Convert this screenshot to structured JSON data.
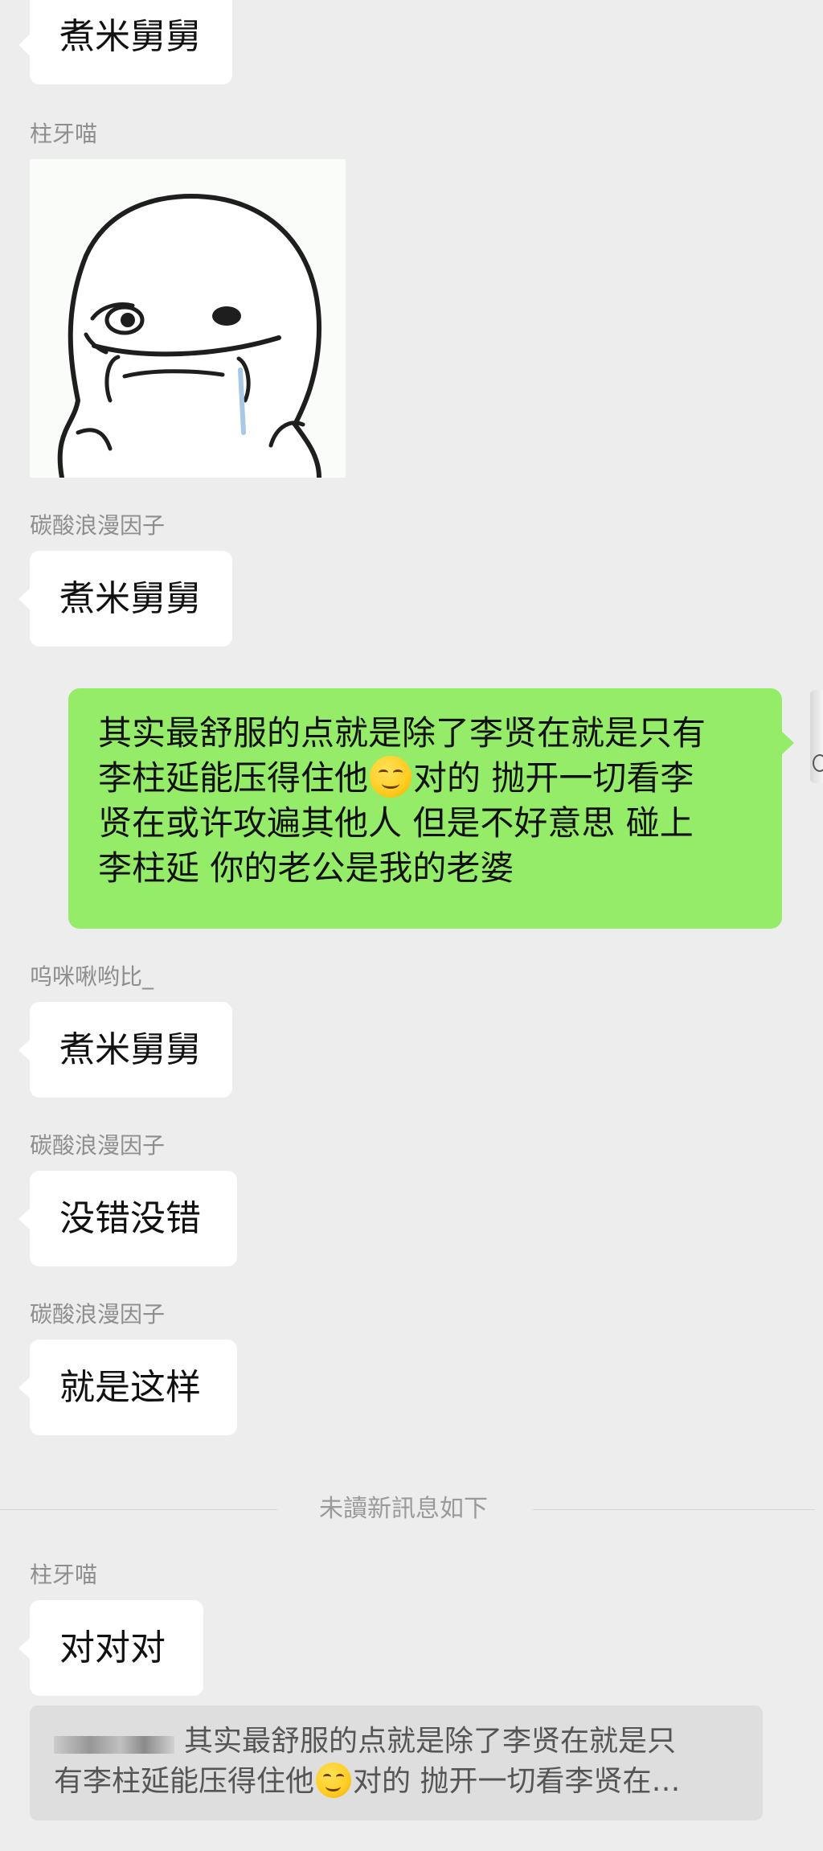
{
  "messages": [
    {
      "kind": "text",
      "text": "煮米舅舅"
    },
    {
      "kind": "sender",
      "name": "柱牙喵"
    },
    {
      "kind": "sticker"
    },
    {
      "kind": "sender",
      "name": "碳酸浪漫因子"
    },
    {
      "kind": "text",
      "text": "煮米舅舅"
    }
  ],
  "mine": {
    "line1": "其实最舒服的点就是除了李贤在就是只有",
    "line2a": "李柱延能压得住他",
    "line2b": "对的 抛开一切看李",
    "line3": "贤在或许攻遍其他人 但是不好意思 碰上",
    "line4": "李柱延 你的老公是我的老婆",
    "emoji": "smirk-face-icon"
  },
  "after": [
    {
      "sender": "呜咪啾哟比_",
      "text": "煮米舅舅"
    },
    {
      "sender": "碳酸浪漫因子",
      "text": "没错没错"
    },
    {
      "sender": "碳酸浪漫因子",
      "text": "就是这样"
    }
  ],
  "divider": "未讀新訊息如下",
  "unread": {
    "sender": "柱牙喵",
    "text": "对对对"
  },
  "quote": {
    "line1": "其实最舒服的点就是除了李贤在就是只",
    "line2a": "有李柱延能压得住他",
    "line2b": "对的 抛开一切看李贤在…"
  },
  "colors": {
    "background": "#ededed",
    "mine_bubble": "#95ec69",
    "other_bubble": "#ffffff",
    "quote_bg": "#dedede"
  }
}
